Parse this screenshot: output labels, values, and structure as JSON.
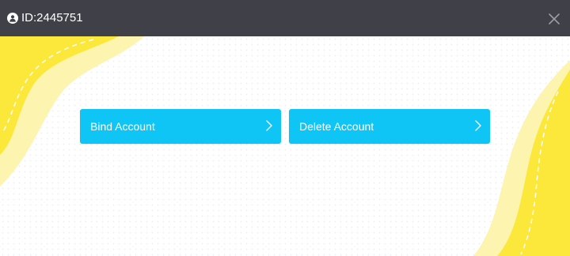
{
  "header": {
    "account_id": "ID:2445751",
    "avatar_icon": "user-icon",
    "close_icon": "close-icon"
  },
  "actions": {
    "bind_label": "Bind Account",
    "delete_label": "Delete Account",
    "chevron_icon": "chevron-right-icon"
  },
  "colors": {
    "titlebar": "#3f4048",
    "button": "#0fc5f6",
    "accent_yellow": "#fbe83b",
    "accent_pale": "#fdf4b0"
  }
}
